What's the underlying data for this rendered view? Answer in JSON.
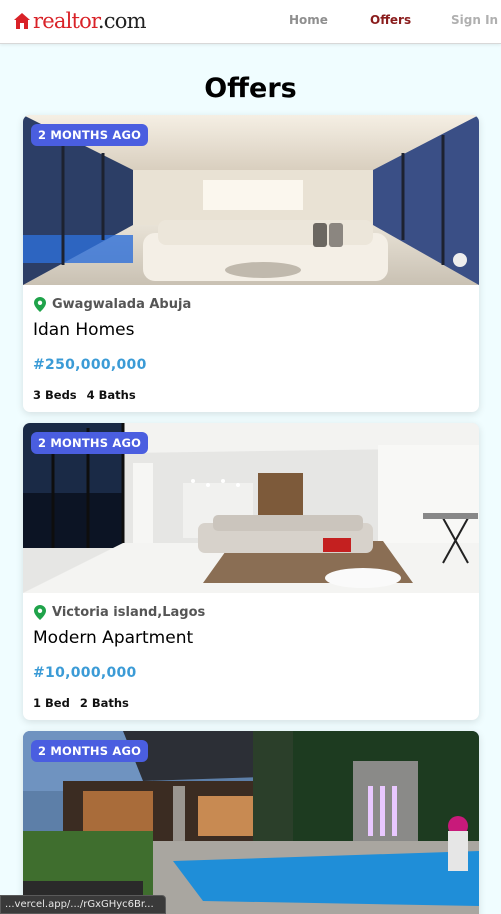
{
  "header": {
    "logo_text": "realtor",
    "logo_suffix": ".com",
    "nav": {
      "home": "Home",
      "offers": "Offers",
      "sign_in": "Sign In"
    }
  },
  "page": {
    "title": "Offers"
  },
  "listings": [
    {
      "badge": "2 MONTHS AGO",
      "location": "Gwagwalada Abuja",
      "name": "Idan Homes",
      "price": "#250,000,000",
      "beds": "3 Beds",
      "baths": "4 Baths"
    },
    {
      "badge": "2 MONTHS AGO",
      "location": "Victoria island,Lagos",
      "name": "Modern Apartment",
      "price": "#10,000,000",
      "beds": "1 Bed",
      "baths": "2 Baths"
    },
    {
      "badge": "2 MONTHS AGO"
    }
  ],
  "status_bar": {
    "url": "...vercel.app/.../rGxGHyc6Br..."
  },
  "colors": {
    "brand_red": "#d92228",
    "active_nav": "#8a1c1c",
    "badge_bg": "#4a5ee0",
    "price": "#3b9bd6",
    "location_pin": "#1fa34a",
    "page_bg": "#f0fdff"
  },
  "icons": {
    "logo": "house-icon",
    "location": "map-pin-icon"
  }
}
